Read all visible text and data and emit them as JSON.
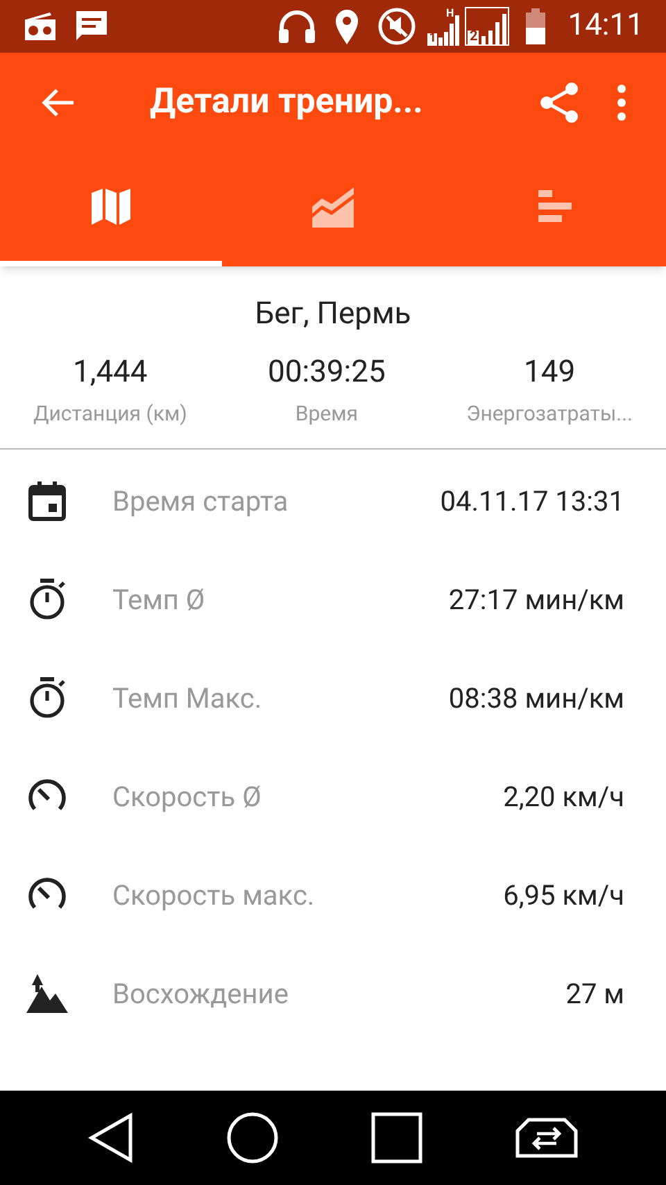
{
  "status_bar": {
    "network_type": "H",
    "sims": [
      "1",
      "2"
    ],
    "time": "14:11"
  },
  "toolbar": {
    "title": "Детали тренир..."
  },
  "tabs": [
    {
      "kind": "map",
      "selected": true
    },
    {
      "kind": "chart",
      "selected": false
    },
    {
      "kind": "bars",
      "selected": false
    }
  ],
  "workout": {
    "title": "Бег, Пермь",
    "stats": [
      {
        "value": "1,444",
        "label": "Дистанция (км)"
      },
      {
        "value": "00:39:25",
        "label": "Время"
      },
      {
        "value": "149",
        "label": "Энергозатраты..."
      }
    ]
  },
  "details": [
    {
      "kind": "calendar",
      "label": "Время старта",
      "value": "04.11.17 13:31"
    },
    {
      "kind": "stopwatch",
      "label": "Темп Ø",
      "value": "27:17 мин/км"
    },
    {
      "kind": "stopwatch",
      "label": "Темп Макс.",
      "value": "08:38 мин/км"
    },
    {
      "kind": "speedometer",
      "label": "Скорость Ø",
      "value": "2,20 км/ч"
    },
    {
      "kind": "speedometer",
      "label": "Скорость макс.",
      "value": "6,95 км/ч"
    },
    {
      "kind": "ascent",
      "label": "Восхождение",
      "value": "27 м"
    }
  ]
}
